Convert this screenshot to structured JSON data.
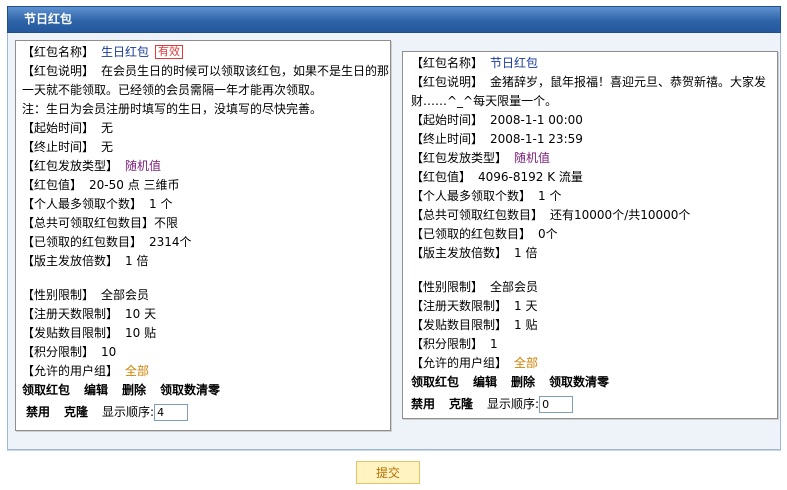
{
  "header": {
    "title": "节日红包"
  },
  "left": {
    "name_label": "【红包名称】",
    "name_value": "生日红包",
    "status_badge": "有效",
    "desc_label": "【红包说明】",
    "desc_value": "在会员生日的时候可以领取该红包，如果不是生日的那一天就不能领取。已经领的会员需隔一年才能再次领取。",
    "note": "注：生日为会员注册时填写的生日，没填写的尽快完善。",
    "start_label": "【起始时间】",
    "start_value": "无",
    "end_label": "【终止时间】",
    "end_value": "无",
    "type_label": "【红包发放类型】",
    "type_value": "随机值",
    "amount_label": "【红包值】",
    "amount_value": "20-50 点  三维币",
    "per_user_label": "【个人最多领取个数】",
    "per_user_value": "1 个",
    "total_label": "【总共可领取红包数目】",
    "total_value": "不限",
    "claimed_label": "【已领取的红包数目】",
    "claimed_value": "2314个",
    "multiplier_label": "【版主发放倍数】",
    "multiplier_value": "1 倍",
    "gender_label": "【性别限制】",
    "gender_value": "全部会员",
    "regdays_label": "【注册天数限制】",
    "regdays_value": "10 天",
    "posts_label": "【发贴数目限制】",
    "posts_value": "10 贴",
    "points_label": "【积分限制】",
    "points_value": "10",
    "groups_label": "【允许的用户组】",
    "groups_value": "全部",
    "actions": [
      "领取红包",
      "编辑",
      "删除",
      "领取数清零"
    ],
    "actions2": [
      "禁用",
      "克隆"
    ],
    "order_label": "显示顺序:",
    "order_value": "4"
  },
  "right": {
    "name_label": "【红包名称】",
    "name_value": "节日红包",
    "desc_label": "【红包说明】",
    "desc_value": "金猪辞岁，鼠年报福！喜迎元旦、恭贺新禧。大家发财……^_^每天限量一个。",
    "start_label": "【起始时间】",
    "start_value": "2008-1-1 00:00",
    "end_label": "【终止时间】",
    "end_value": "2008-1-1 23:59",
    "type_label": "【红包发放类型】",
    "type_value": "随机值",
    "amount_label": "【红包值】",
    "amount_value": "4096-8192 K 流量",
    "per_user_label": "【个人最多领取个数】",
    "per_user_value": "1 个",
    "total_label": "【总共可领取红包数目】",
    "total_value": "还有10000个/共10000个",
    "claimed_label": "【已领取的红包数目】",
    "claimed_value": "0个",
    "multiplier_label": "【版主发放倍数】",
    "multiplier_value": "1 倍",
    "gender_label": "【性别限制】",
    "gender_value": "全部会员",
    "regdays_label": "【注册天数限制】",
    "regdays_value": "1 天",
    "posts_label": "【发贴数目限制】",
    "posts_value": "1 贴",
    "points_label": "【积分限制】",
    "points_value": "1",
    "groups_label": "【允许的用户组】",
    "groups_value": "全部",
    "actions": [
      "领取红包",
      "编辑",
      "删除",
      "领取数清零"
    ],
    "actions2": [
      "禁用",
      "克隆"
    ],
    "order_label": "显示顺序:",
    "order_value": "0"
  },
  "submit_label": "提交"
}
